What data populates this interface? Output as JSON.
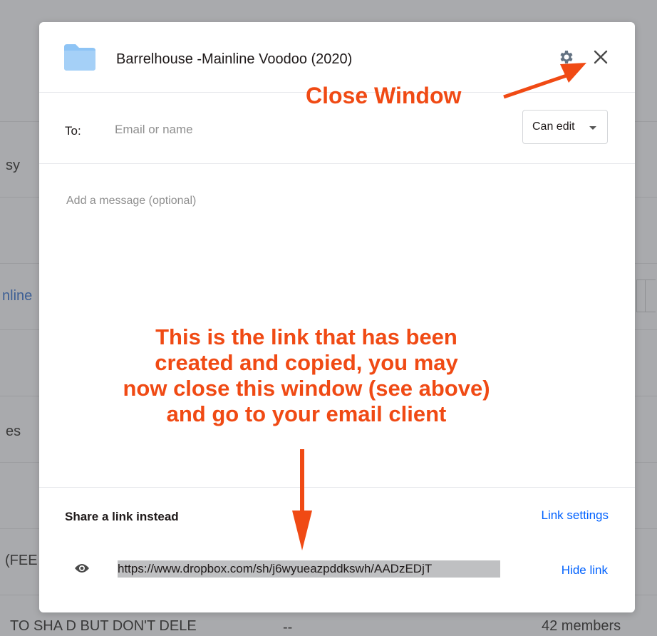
{
  "background": {
    "fragments": [
      "sy",
      "nline",
      "es",
      "(FEE",
      "TO SHA   D BUT DON'T DELE",
      "--",
      "42 members"
    ]
  },
  "modal": {
    "title": "Barrelhouse -Mainline Voodoo (2020)",
    "icons": {
      "folder": "folder-icon",
      "settings": "gear-icon",
      "close": "close-icon"
    },
    "to": {
      "label": "To:",
      "placeholder": "Email or name",
      "value": ""
    },
    "permission": {
      "selected": "Can edit"
    },
    "message": {
      "placeholder": "Add a message (optional)",
      "value": ""
    },
    "share_link": {
      "title": "Share a link instead",
      "settings_label": "Link settings",
      "url": "https://www.dropbox.com/sh/j6wyueazpddkswh/AADzEDjT",
      "hide_label": "Hide link",
      "icon": "eye-icon"
    }
  },
  "annotations": {
    "close_label": "Close Window",
    "body_lines": [
      "This is the link that has been",
      "created and copied, you may",
      "now close this window (see above)",
      "and go to your email client"
    ],
    "color": "#f04a14"
  },
  "colors": {
    "accent": "#0061fe",
    "folder": "#8ec4f5",
    "annotation": "#f04a14"
  }
}
